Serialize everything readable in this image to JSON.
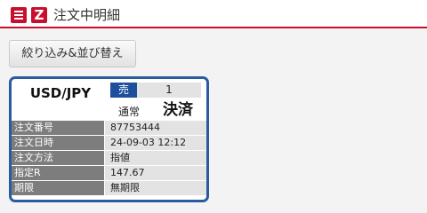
{
  "header": {
    "title": "注文中明細",
    "logo_letter": "Z",
    "icons": [
      "menu-icon",
      "logo-icon"
    ],
    "accent_color": "#c8102e"
  },
  "toolbar": {
    "filter_sort_label": "絞り込み&並び替え"
  },
  "order_card": {
    "pair": "USD/JPY",
    "side": "売",
    "quantity": "1",
    "order_type": "通常",
    "status": "決済",
    "border_color": "#2a5aa0",
    "rows": [
      {
        "label": "注文番号",
        "value": "87753444"
      },
      {
        "label": "注文日時",
        "value": "24-09-03 12:12"
      },
      {
        "label": "注文方法",
        "value": "指値"
      },
      {
        "label": "指定R",
        "value": "147.67"
      },
      {
        "label": "期限",
        "value": "無期限"
      }
    ]
  }
}
